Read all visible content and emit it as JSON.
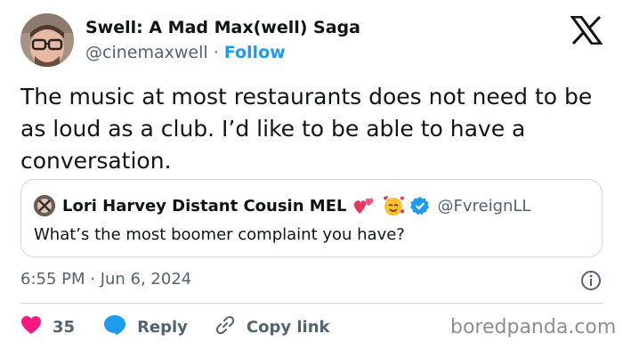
{
  "author": {
    "name": "Swell: A Mad Max(well) Saga",
    "handle": "@cinemaxwell",
    "separator": "·",
    "follow_label": "Follow"
  },
  "tweet": {
    "text": "The music at most restaurants does not need to be as loud as a club. I’d like to be able to have a conversation."
  },
  "quoted_tweet": {
    "author_name": "Lori Harvey Distant Cousin MEL",
    "author_handle": "@FvreignLL",
    "text": "What’s the most boomer complaint you have?"
  },
  "meta": {
    "timestamp": "6:55 PM · Jun 6, 2024"
  },
  "actions": {
    "like_count": "35",
    "reply_label": "Reply",
    "copy_link_label": "Copy link"
  },
  "watermark": "boredpanda.com",
  "colors": {
    "accent": "#1d9bf0",
    "like": "#f91880",
    "text_primary": "#0f1419",
    "text_secondary": "#536471",
    "border": "#cfd9de"
  },
  "icons": [
    "x-logo-icon",
    "verified-badge-icon",
    "info-icon",
    "heart-icon",
    "reply-bubble-icon",
    "link-icon",
    "hearts-emoji-icon",
    "smiling-face-with-hearts-emoji-icon"
  ]
}
